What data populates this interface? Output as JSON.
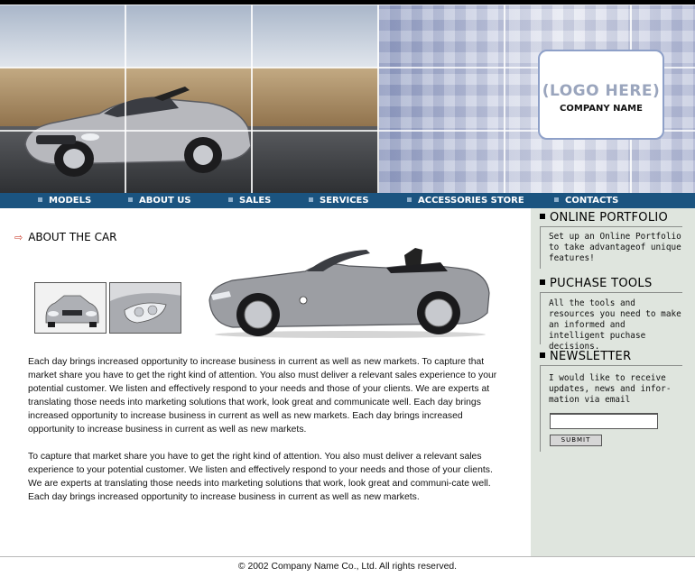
{
  "header": {
    "logo_text": "(LOGO HERE)",
    "company_name": "COMPANY NAME"
  },
  "nav": {
    "items": [
      {
        "label": "MODELS"
      },
      {
        "label": "ABOUT US"
      },
      {
        "label": "SALES"
      },
      {
        "label": "SERVICES"
      },
      {
        "label": "ACCESSORIES STORE"
      },
      {
        "label": "CONTACTS"
      }
    ]
  },
  "main": {
    "heading": "ABOUT THE CAR",
    "paragraphs": [
      "Each day brings increased opportunity to increase business in current as well as new markets. To capture that market share you have to get the right kind of attention. You also must deliver a relevant sales experience to your potential customer. We listen and effectively respond to your needs and those of your clients. We are experts at translating those needs into marketing solutions that work, look great and communicate well. Each day brings increased opportunity to increase business in current as well as new markets. Each day brings increased opportunity to increase business in current as well as new markets.",
      "To capture that market share you have to get the right kind of attention. You also must deliver a relevant sales experience to your potential customer. We listen and effectively respond to your needs and those of your clients. We are experts at translating those needs into marketing solutions that work, look great and communi-cate well. Each day brings increased opportunity to increase business in current as well as new markets."
    ]
  },
  "sidebar": {
    "online_portfolio": {
      "title": "ONLINE PORTFOLIO",
      "text": "Set up an Online Portfolio to take advantageof unique features!"
    },
    "puchase_tools": {
      "title": "PUCHASE TOOLS",
      "text": "All the tools and resources you need to make an informed and intelligent puchase decisions."
    },
    "newsletter": {
      "title": "NEWSLETTER",
      "text": "I would like to receive updates, news and infor-mation via email",
      "email_value": "",
      "submit_label": "SUBMIT"
    }
  },
  "footer": {
    "copyright": "© 2002 Company Name Co., Ltd. All rights reserved."
  },
  "colors": {
    "nav_bg": "#1b5480",
    "sidebar_bg": "#dfe5de",
    "heading_arrow": "#cc4433"
  }
}
